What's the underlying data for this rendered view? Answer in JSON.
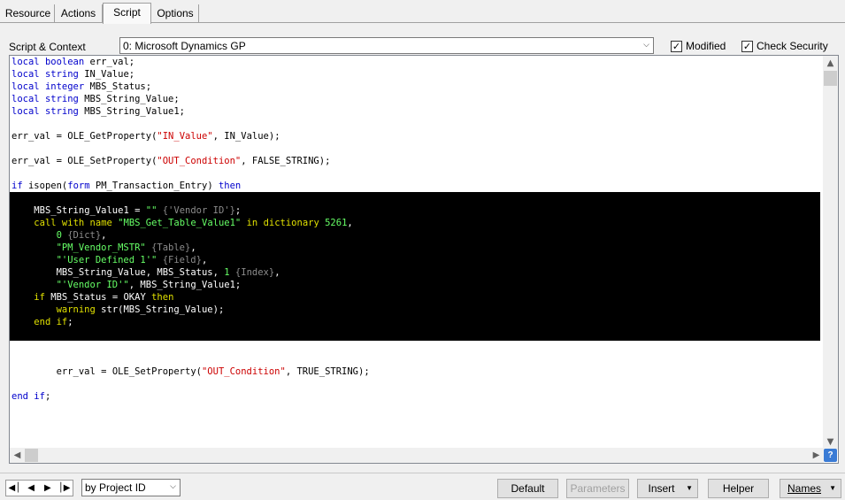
{
  "tabs": [
    {
      "label": "Resource"
    },
    {
      "label": "Actions"
    },
    {
      "label": "Script"
    },
    {
      "label": "Options"
    }
  ],
  "context": {
    "label": "Script & Context",
    "selected": "0: Microsoft Dynamics GP"
  },
  "checks": {
    "modified": {
      "label": "Modified",
      "checked": true
    },
    "check_security": {
      "label": "Check Security",
      "checked": true
    }
  },
  "code_lines": [
    "local boolean err_val;",
    "local string IN_Value;",
    "local integer MBS_Status;",
    "local string MBS_String_Value;",
    "local string MBS_String_Value1;",
    "",
    "err_val = OLE_GetProperty(\"IN_Value\", IN_Value);",
    "",
    "err_val = OLE_SetProperty(\"OUT_Condition\", FALSE_STRING);",
    "",
    "if isopen(form PM_Transaction_Entry) then",
    "",
    "    MBS_String_Value1 = \"\" {'Vendor ID'};",
    "    call with name \"MBS_Get_Table_Value1\" in dictionary 5261,",
    "        0 {Dict},",
    "        \"PM_Vendor_MSTR\" {Table},",
    "        \"'User Defined 1'\" {Field},",
    "        MBS_String_Value, MBS_Status, 1 {Index},",
    "        \"'Vendor ID'\", MBS_String_Value1;",
    "    if MBS_Status = OKAY then",
    "        warning str(MBS_String_Value);",
    "    end if;",
    "",
    "",
    "",
    "        err_val = OLE_SetProperty(\"OUT_Condition\", TRUE_STRING);",
    "",
    "end if;"
  ],
  "bottom": {
    "lookup_selected": "by Project ID",
    "default_label": "Default",
    "parameters_label": "Parameters",
    "insert_label": "Insert",
    "helper_label": "Helper",
    "names_label": "Names"
  },
  "colors": {
    "keyword_light": "#0000cc",
    "string_light": "#cc0000",
    "block_background": "#000000",
    "keyword_dark": "#e0e000",
    "string_dark": "#66ff66",
    "comment_dark": "#8c8c8c"
  },
  "icons": [
    "first-record-icon",
    "previous-record-icon",
    "next-record-icon",
    "last-record-icon",
    "help-icon",
    "dropdown-arrow-icon",
    "scroll-up-icon",
    "scroll-down-icon",
    "scroll-left-icon",
    "scroll-right-icon"
  ]
}
